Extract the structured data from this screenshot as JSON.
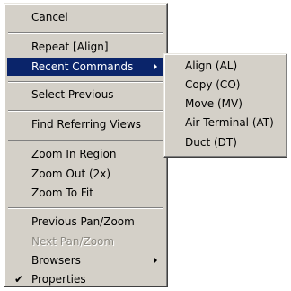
{
  "main_menu": {
    "cancel": "Cancel",
    "repeat": "Repeat [Align]",
    "recent_commands": "Recent Commands",
    "select_previous": "Select Previous",
    "find_referring_views": "Find Referring Views",
    "zoom_in_region": "Zoom In Region",
    "zoom_out": "Zoom Out (2x)",
    "zoom_to_fit": "Zoom To Fit",
    "previous_pan_zoom": "Previous Pan/Zoom",
    "next_pan_zoom": "Next Pan/Zoom",
    "browsers": "Browsers",
    "properties": "Properties",
    "check_glyph": "✔"
  },
  "submenu": {
    "items": [
      "Align (AL)",
      "Copy (CO)",
      "Move (MV)",
      "Air Terminal (AT)",
      "Duct (DT)"
    ]
  },
  "colors": {
    "menu_background": "#d4d0c8",
    "highlight": "#0a246a",
    "disabled_text": "#8d8a82"
  },
  "icons": {
    "submenu_arrow": "submenu-arrow-icon",
    "checkmark": "checkmark-icon"
  }
}
